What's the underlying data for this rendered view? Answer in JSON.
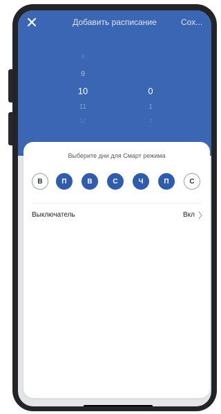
{
  "header": {
    "close_icon": "close-icon",
    "title": "Добавить расписание",
    "save_label": "Сох..."
  },
  "picker": {
    "hours": [
      "8",
      "9",
      "10",
      "11",
      "12"
    ],
    "minutes": [
      "0",
      "1",
      "2"
    ],
    "selected_hour": "10",
    "selected_minute": "0"
  },
  "days": {
    "title": "Выберите дни для Смарт режима",
    "items": [
      {
        "label": "В",
        "selected": false
      },
      {
        "label": "П",
        "selected": true
      },
      {
        "label": "В",
        "selected": true
      },
      {
        "label": "С",
        "selected": true
      },
      {
        "label": "Ч",
        "selected": true
      },
      {
        "label": "П",
        "selected": true
      },
      {
        "label": "С",
        "selected": false
      }
    ]
  },
  "switch_row": {
    "label": "Выключатель",
    "value": "Вкл",
    "chevron_icon": "chevron-right-icon"
  },
  "colors": {
    "header_bg": "#3b66b3",
    "day_selected": "#2f5cad",
    "sheet_bg": "#ffffff",
    "frame": "#232428"
  }
}
